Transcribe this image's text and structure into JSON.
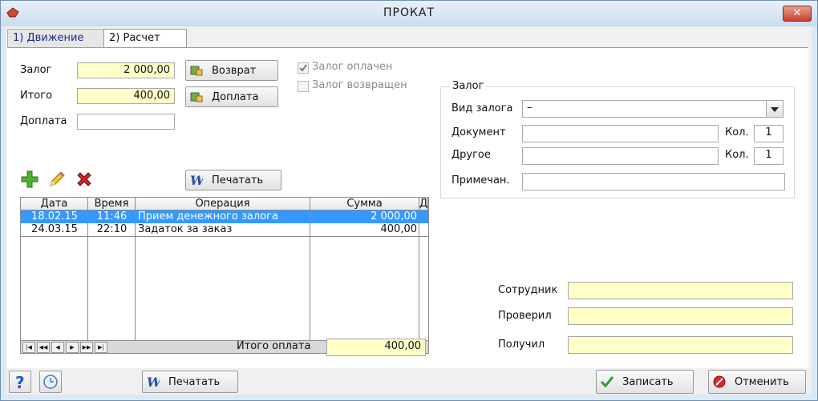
{
  "window": {
    "title": "ПРОКАТ",
    "close_label": "✕"
  },
  "tabs": [
    {
      "label": "1) Движение"
    },
    {
      "label": "2) Расчет"
    }
  ],
  "form": {
    "deposit_label": "Залог",
    "deposit_value": "2 000,00",
    "total_label": "Итого",
    "total_value": "400,00",
    "surcharge_label": "Доплата",
    "surcharge_value": ""
  },
  "buttons": {
    "return_label": "Возврат",
    "surcharge_label": "Доплата",
    "print_label": "Печатать",
    "print_bottom_label": "Печатать",
    "save_label": "Записать",
    "cancel_label": "Отменить"
  },
  "checkboxes": {
    "deposit_paid": {
      "label": "Залог оплачен",
      "checked": true
    },
    "deposit_returned": {
      "label": "Залог возвращен",
      "checked": false
    }
  },
  "deposit_group": {
    "title": "Залог",
    "type_label": "Вид залога",
    "type_value": "–",
    "document_label": "Документ",
    "document_value": "",
    "other_label": "Другое",
    "other_value": "",
    "qty_label": "Кол.",
    "document_qty": "1",
    "other_qty": "1",
    "note_label": "Примечан.",
    "note_value": ""
  },
  "table": {
    "columns": [
      "Дата",
      "Время",
      "Операция",
      "Сумма",
      "Д"
    ],
    "rows": [
      {
        "date": "18.02.15",
        "time": "11:46",
        "operation": "Прием денежного залога",
        "amount": "2 000,00",
        "selected": true
      },
      {
        "date": "24.03.15",
        "time": "22:10",
        "operation": "Задаток за заказ",
        "amount": "400,00",
        "selected": false
      }
    ]
  },
  "total_payment": {
    "label": "Итого оплата",
    "value": "400,00"
  },
  "signatures": {
    "employee_label": "Сотрудник",
    "employee_value": "",
    "checked_label": "Проверил",
    "checked_value": "",
    "received_label": "Получил",
    "received_value": ""
  },
  "colors": {
    "accent_selection": "#3399ff",
    "field_yellow": "#ffffc8"
  }
}
